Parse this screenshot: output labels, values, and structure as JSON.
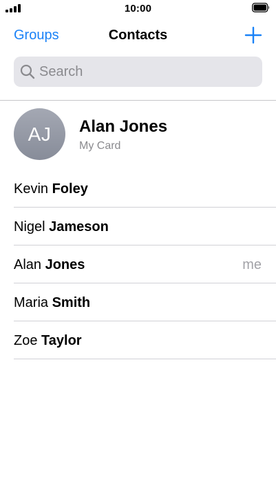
{
  "status_bar": {
    "time": "10:00"
  },
  "nav": {
    "left_label": "Groups",
    "title": "Contacts",
    "add_icon": "plus-icon"
  },
  "search": {
    "placeholder": "Search",
    "icon": "search-icon"
  },
  "my_card": {
    "initials": "AJ",
    "name": "Alan Jones",
    "subtitle": "My Card"
  },
  "contacts": [
    {
      "first": "Kevin",
      "last": "Foley",
      "badge": ""
    },
    {
      "first": "Nigel",
      "last": "Jameson",
      "badge": ""
    },
    {
      "first": "Alan",
      "last": "Jones",
      "badge": "me"
    },
    {
      "first": "Maria",
      "last": "Smith",
      "badge": ""
    },
    {
      "first": "Zoe",
      "last": "Taylor",
      "badge": ""
    }
  ],
  "colors": {
    "accent": "#1a82f7",
    "secondary_text": "#8a8a8e",
    "search_bg": "#e5e5ea"
  }
}
